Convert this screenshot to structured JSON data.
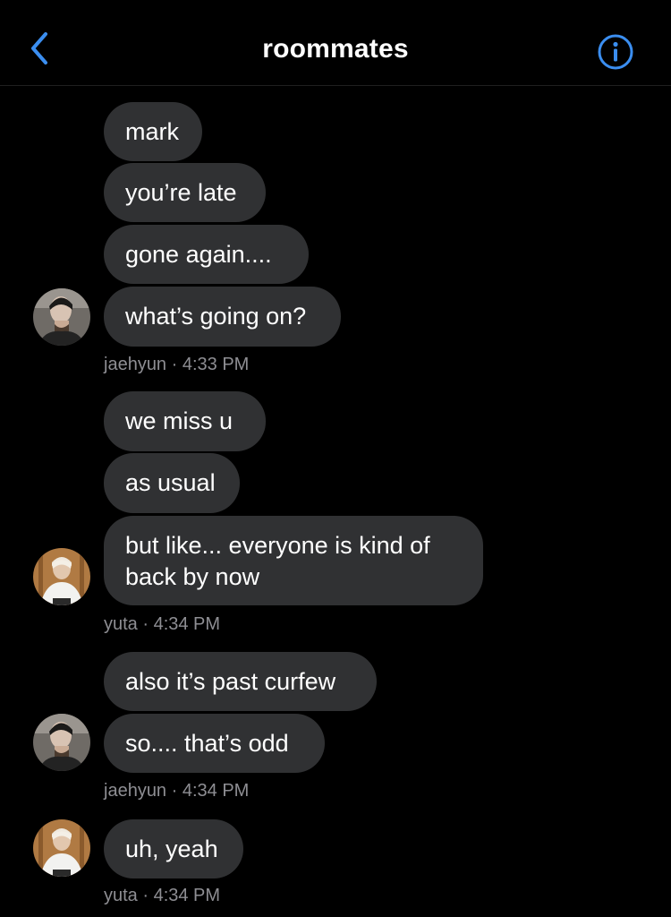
{
  "header": {
    "title": "roommates",
    "back_icon": "chevron-left-icon",
    "info_icon": "info-circle-icon",
    "accent_color": "#3b8ef0"
  },
  "messages": [
    {
      "text": "mark"
    },
    {
      "text": "you’re late"
    },
    {
      "text": "gone again...."
    },
    {
      "text": "what’s going on?"
    },
    {
      "text": "we miss u"
    },
    {
      "text": "as usual"
    },
    {
      "text": "but like... everyone is kind of back by now"
    },
    {
      "text": "also it’s past curfew"
    },
    {
      "text": "so.... that’s odd"
    },
    {
      "text": "uh, yeah"
    }
  ],
  "groups": [
    {
      "sender": "jaehyun",
      "time": "4:33 PM",
      "meta": "jaehyun · 4:33 PM"
    },
    {
      "sender": "yuta",
      "time": "4:34 PM",
      "meta": "yuta · 4:34 PM"
    },
    {
      "sender": "jaehyun",
      "time": "4:34 PM",
      "meta": "jaehyun · 4:34 PM"
    },
    {
      "sender": "yuta",
      "time": "4:34 PM",
      "meta": "yuta · 4:34 PM"
    }
  ],
  "colors": {
    "background": "#000000",
    "bubble": "#303133",
    "meta_text": "#8e8e93"
  }
}
